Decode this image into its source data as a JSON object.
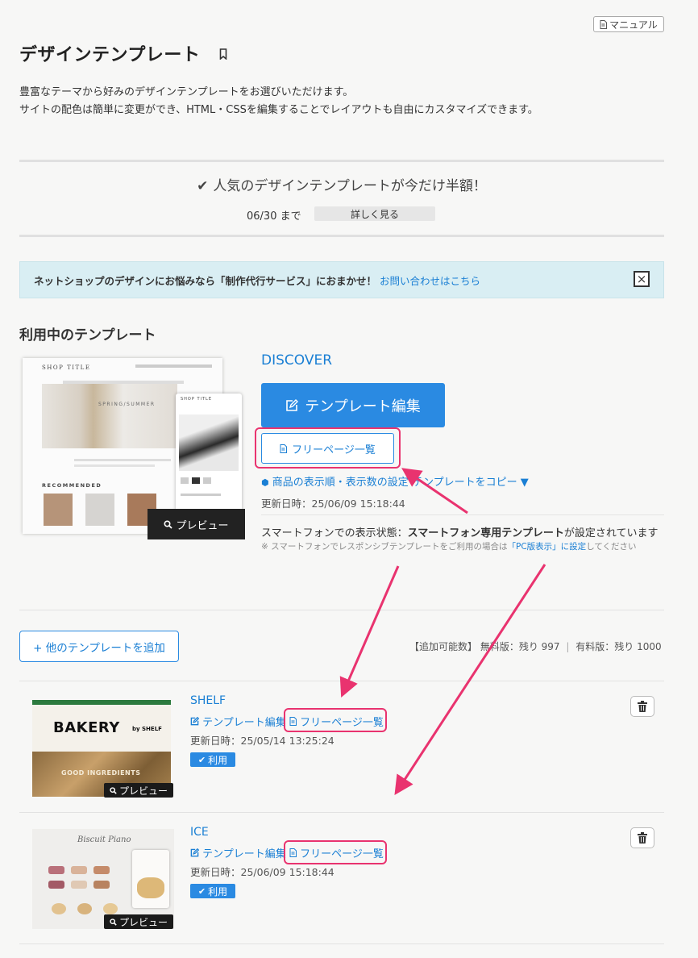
{
  "manual_label": "マニュアル",
  "page_title": "デザインテンプレート",
  "description": [
    "豊富なテーマから好みのデザインテンプレートをお選びいただけます。",
    "サイトの配色は簡単に変更ができ、HTML・CSSを編集することでレイアウトも自由にカスタマイズできます。"
  ],
  "promo": {
    "text": "人気のデザインテンプレートが今だけ半額！",
    "deadline": "06/30 まで",
    "more": "詳しく見る"
  },
  "notice": {
    "text": "ネットショップのデザインにお悩みなら「制作代行サービス」におまかせ！",
    "link": "お問い合わせはこちら",
    "close": "×"
  },
  "current": {
    "section_title": "利用中のテンプレート",
    "name": "DISCOVER",
    "edit_label": "テンプレート編集",
    "freepage_label": "フリーページ一覧",
    "order_label": "商品の表示順・表示数の設定",
    "copy_label": "テンプレートをコピー ▼",
    "updated": "更新日時：25/06/09 15:18:44",
    "sp_status_prefix": "スマートフォンでの表示状態：",
    "sp_status_bold": "スマートフォン専用テンプレート",
    "sp_status_suffix": "が設定されています",
    "sp_note_prefix": "※ スマートフォンでレスポンシブテンプレートをご利用の場合は",
    "sp_note_link": "「PC版表示」に設定",
    "sp_note_suffix": "してください",
    "preview_label": "プレビュー",
    "thumb": {
      "shop_title": "SHOP TITLE",
      "season": "SPRING/SUMMER",
      "recommended": "RECOMMENDED"
    }
  },
  "add_button": "+ 他のテンプレートを追加",
  "quota": {
    "label": "【追加可能数】",
    "free": "無料版：残り 997",
    "sep": "|",
    "paid": "有料版：残り 1000"
  },
  "templates": [
    {
      "name": "SHELF",
      "edit_label": "テンプレート編集",
      "freepage_label": "フリーページ一覧",
      "updated": "更新日時：25/05/14 13:25:24",
      "use_label": "利用",
      "preview_label": "プレビュー",
      "thumb_text": "BAKERY",
      "thumb_sub": "by SHELF",
      "thumb_caption": "GOOD INGREDIENTS"
    },
    {
      "name": "ICE",
      "edit_label": "テンプレート編集",
      "freepage_label": "フリーページ一覧",
      "updated": "更新日時：25/06/09 15:18:44",
      "use_label": "利用",
      "preview_label": "プレビュー",
      "thumb_text": "Biscuit Piano"
    }
  ],
  "colors": {
    "accent": "#2a8ae2",
    "highlight": "#e9336f",
    "notice_bg": "#d9eef3"
  }
}
